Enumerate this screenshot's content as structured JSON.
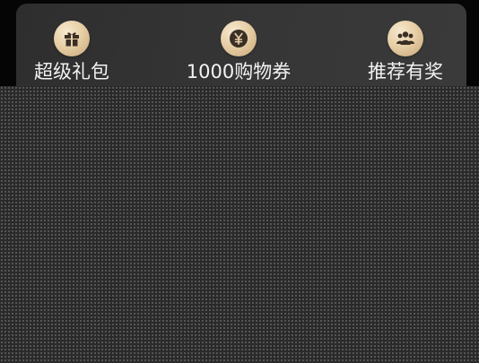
{
  "benefits": {
    "items": [
      {
        "icon": "gift-icon",
        "label": "超级礼包"
      },
      {
        "icon": "yen-coin-icon",
        "label": "1000购物券"
      },
      {
        "icon": "group-icon",
        "label": "推荐有奖"
      }
    ]
  },
  "colors": {
    "icon_gold": "#e7cfa6",
    "icon_glyph": "#3a2f25",
    "label_text": "#f3f3f3",
    "card_background": "#333333"
  }
}
